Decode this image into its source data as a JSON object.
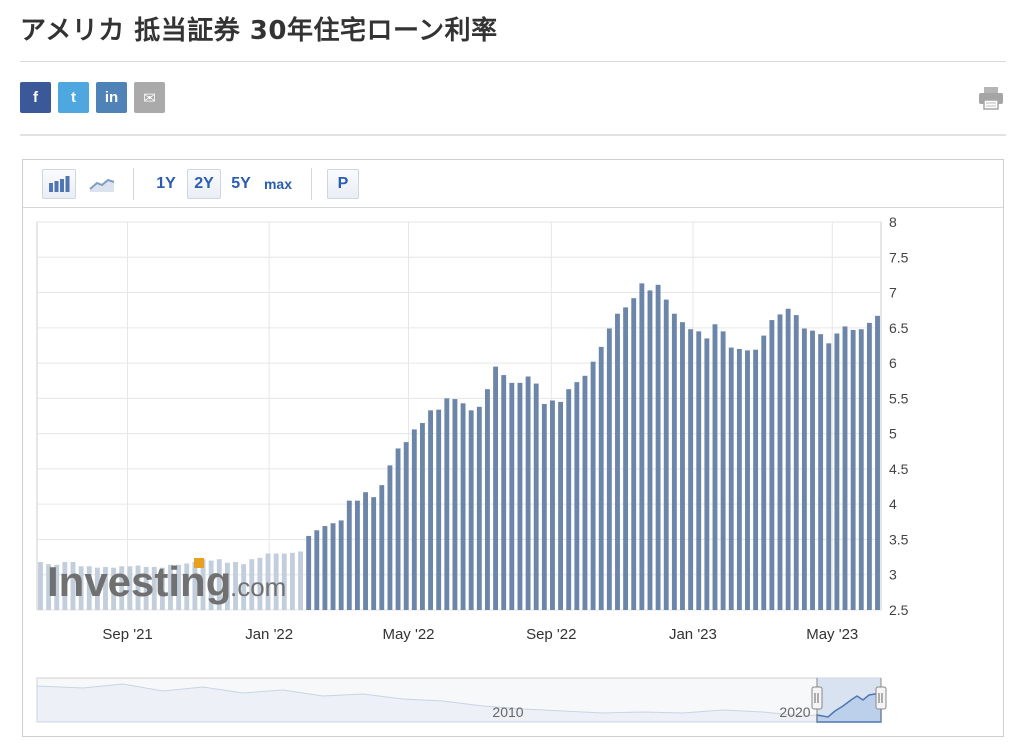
{
  "page": {
    "title": "アメリカ 抵当証券 30年住宅ローン利率"
  },
  "share": [
    {
      "label": "f",
      "name": "facebook-share-button",
      "color": "#3b5998"
    },
    {
      "label": "t",
      "name": "twitter-share-button",
      "color": "#4fa7e0"
    },
    {
      "label": "in",
      "name": "linkedin-share-button",
      "color": "#4f83b8"
    },
    {
      "label": "✉",
      "name": "email-share-button",
      "color": "#aaaaaa"
    }
  ],
  "toolbar": {
    "range_1y": "1Y",
    "range_2y": "2Y",
    "range_5y": "5Y",
    "range_max": "max",
    "period": "P",
    "selected": "2Y"
  },
  "colors": {
    "bar": "#6c86aa",
    "bar_faded": "#c3cedd",
    "grid": "#e6e6e6",
    "nav_fill": "#dde6f3",
    "nav_line": "#9fb4d1"
  },
  "watermark": {
    "brand": "Investing",
    "suffix": ".com"
  },
  "navigator": {
    "labels": [
      "2010",
      "2020"
    ]
  },
  "chart_data": {
    "type": "bar",
    "title": "アメリカ 抵当証券 30年住宅ローン利率",
    "xlabel": "",
    "ylabel": "",
    "ylim": [
      2.5,
      8
    ],
    "yticks": [
      2.5,
      3,
      3.5,
      4,
      4.5,
      5,
      5.5,
      6,
      6.5,
      7,
      7.5,
      8
    ],
    "xtick_labels": [
      "Sep '21",
      "Jan '22",
      "May '22",
      "Sep '22",
      "Jan '23",
      "May '23"
    ],
    "grid": true,
    "start_date": "2021-06-18",
    "interval_days": 7,
    "values": [
      3.18,
      3.15,
      3.14,
      3.18,
      3.18,
      3.12,
      3.12,
      3.1,
      3.11,
      3.1,
      3.12,
      3.12,
      3.13,
      3.11,
      3.11,
      3.1,
      3.14,
      3.14,
      3.16,
      3.18,
      3.22,
      3.2,
      3.22,
      3.17,
      3.18,
      3.15,
      3.22,
      3.24,
      3.3,
      3.3,
      3.3,
      3.31,
      3.33,
      3.55,
      3.63,
      3.69,
      3.73,
      3.77,
      4.05,
      4.05,
      4.17,
      4.1,
      4.27,
      4.55,
      4.79,
      4.88,
      5.06,
      5.15,
      5.33,
      5.34,
      5.5,
      5.49,
      5.43,
      5.33,
      5.38,
      5.63,
      5.95,
      5.83,
      5.72,
      5.72,
      5.81,
      5.71,
      5.42,
      5.47,
      5.45,
      5.63,
      5.73,
      5.82,
      6.02,
      6.23,
      6.49,
      6.7,
      6.79,
      6.92,
      7.13,
      7.03,
      7.11,
      6.9,
      6.7,
      6.58,
      6.48,
      6.45,
      6.35,
      6.55,
      6.45,
      6.22,
      6.2,
      6.18,
      6.19,
      6.39,
      6.61,
      6.69,
      6.77,
      6.68,
      6.49,
      6.46,
      6.41,
      6.28,
      6.42,
      6.52,
      6.47,
      6.48,
      6.57,
      6.67
    ],
    "faded_count": 33
  }
}
